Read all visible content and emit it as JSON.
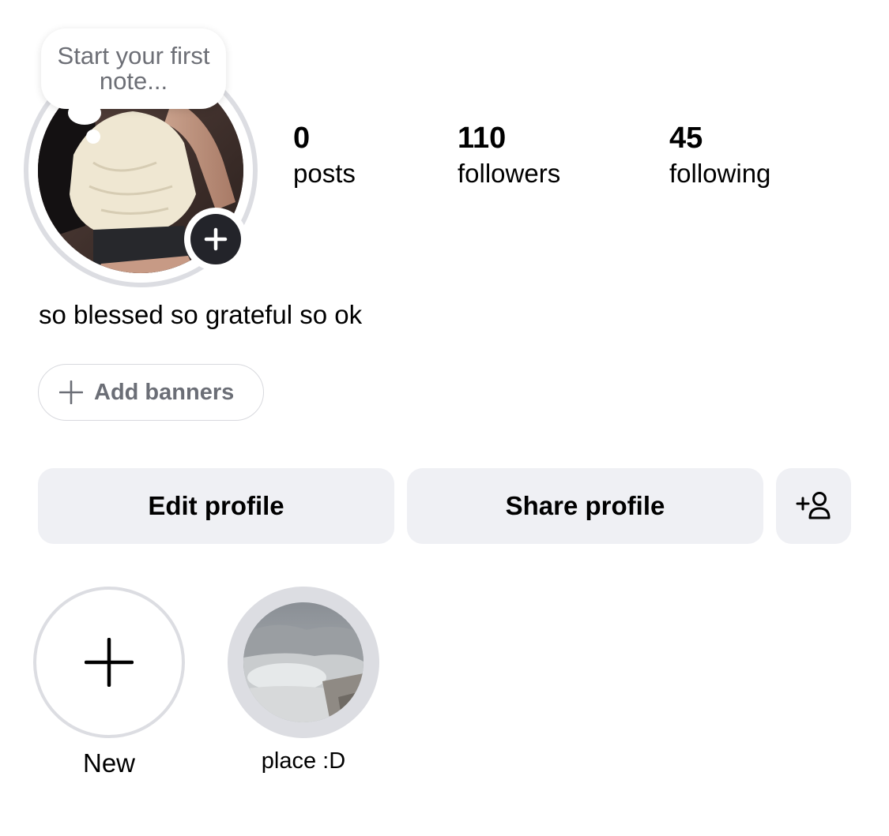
{
  "note": {
    "text": "Start your first note..."
  },
  "stats": [
    {
      "value": "0",
      "label": "posts"
    },
    {
      "value": "110",
      "label": "followers"
    },
    {
      "value": "45",
      "label": "following"
    }
  ],
  "bio": "so blessed so grateful so ok",
  "banners": {
    "label": "Add banners"
  },
  "actions": {
    "edit_label": "Edit profile",
    "share_label": "Share profile",
    "discover_icon": "add-person-icon"
  },
  "highlights": [
    {
      "label": "New",
      "icon": "plus-icon"
    },
    {
      "label": "place :D"
    }
  ],
  "colors": {
    "button_bg": "#eff0f4",
    "ring": "#dcdde2",
    "avatar_badge": "#23242a",
    "muted_text": "#6d6f76"
  }
}
